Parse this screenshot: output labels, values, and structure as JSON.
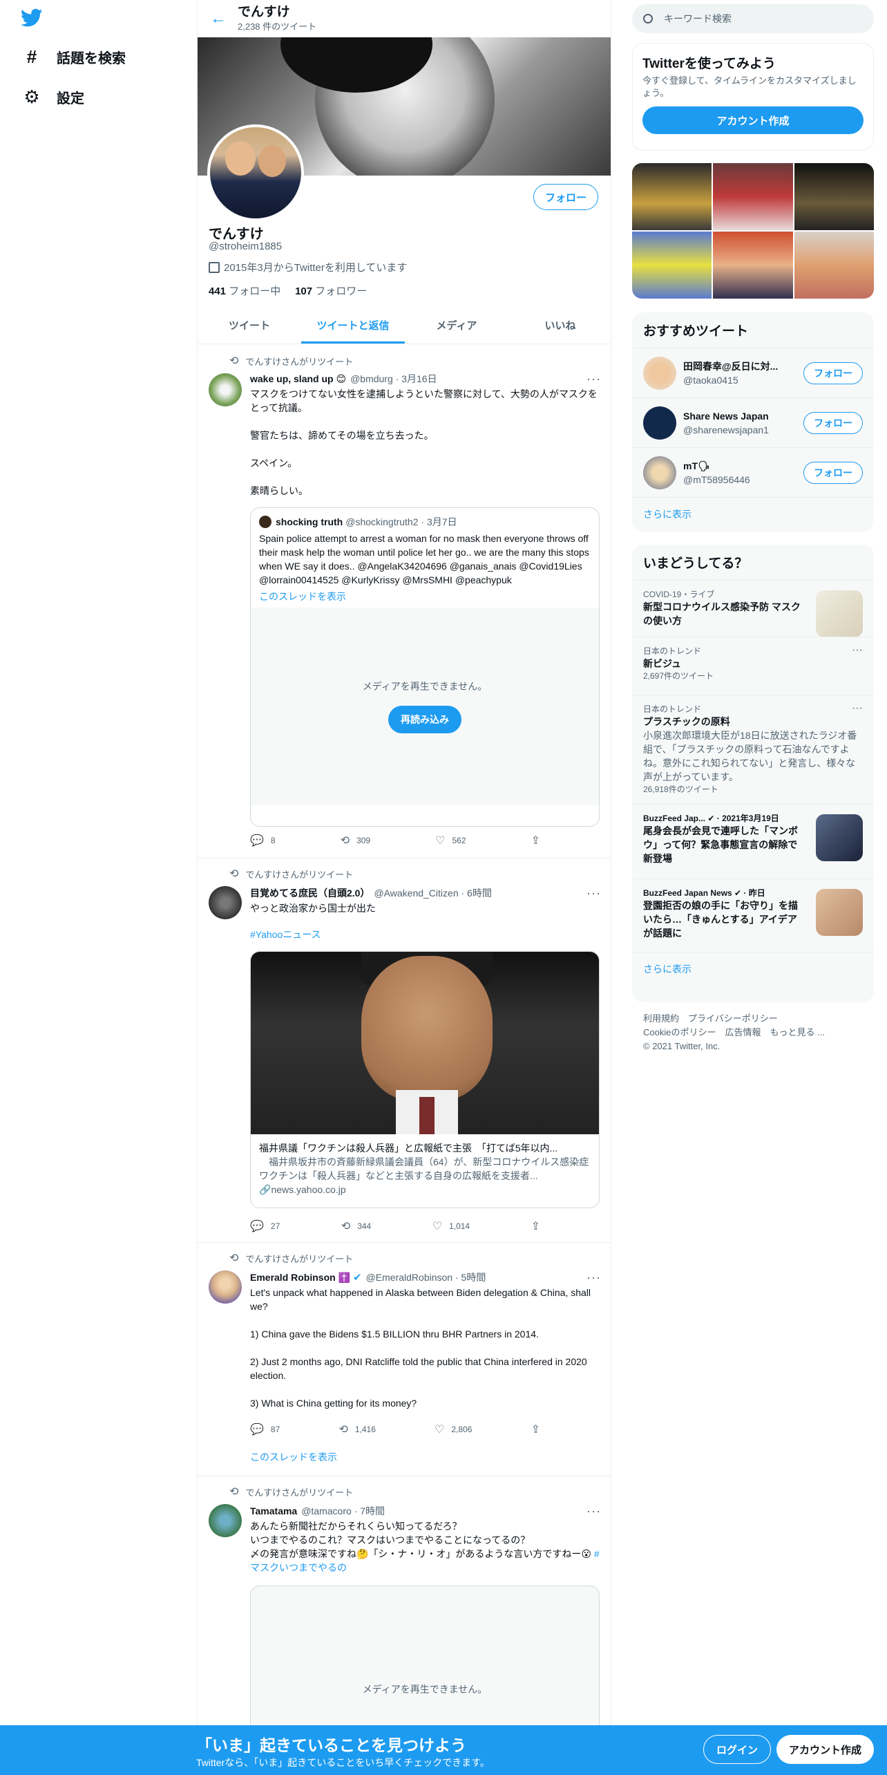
{
  "nav": {
    "explore_label": "話題を検索",
    "settings_label": "設定"
  },
  "header": {
    "name": "でんすけ",
    "tweet_count": "2,238 件のツイート"
  },
  "profile": {
    "follow_label": "フォロー",
    "name": "でんすけ",
    "handle": "@stroheim1885",
    "joined": "2015年3月からTwitterを利用しています",
    "following_count": "441",
    "following_label": "フォロー中",
    "followers_count": "107",
    "followers_label": "フォロワー"
  },
  "tabs": [
    {
      "label": "ツイート"
    },
    {
      "label": "ツイートと返信"
    },
    {
      "label": "メディア"
    },
    {
      "label": "いいね"
    }
  ],
  "tweets": [
    {
      "rt_label": "でんすけさんがリツイート",
      "name": "wake up, sland up 😊",
      "meta": "@bmdurg · 3月16日",
      "body": [
        "マスクをつけてない女性を逮捕しようといた警察に対して、大勢の人がマスクをとって抗議。",
        "警官たちは、諦めてその場を立ち去った。",
        "スペイン。",
        "素晴らしい。"
      ],
      "quote": {
        "name": "shocking truth",
        "meta": "@shockingtruth2 · 3月7日",
        "text": "Spain police attempt to arrest a woman for no mask then everyone throws off their mask help the woman until police let her go.. we are the many this stops when WE say it does.. @AngelaK34204696 @ganais_anais @Covid19Lies @lorrain00414525 @KurlyKrissy @MrsSMHI @peachypuk",
        "thread_link": "このスレッドを表示",
        "media_error": "メディアを再生できません。",
        "reload": "再読み込み"
      },
      "replies": "8",
      "retweets": "309",
      "likes": "562"
    },
    {
      "rt_label": "でんすけさんがリツイート",
      "name": "目覚めてる庶民（自頭2.0）",
      "meta": "@Awakend_Citizen · 6時間",
      "body": [
        "やっと政治家から国士が出た"
      ],
      "hashtag": "#Yahooニュース",
      "card": {
        "title": "福井県議「ワクチンは殺人兵器」と広報紙で主張　「打てば5年以内...",
        "desc": "　福井県坂井市の斉藤新緑県議会議員（64）が、新型コロナウイルス感染症ワクチンは「殺人兵器」などと主張する自身の広報紙を支援者...",
        "url": "news.yahoo.co.jp"
      },
      "replies": "27",
      "retweets": "344",
      "likes": "1,014"
    },
    {
      "rt_label": "でんすけさんがリツイート",
      "name": "Emerald Robinson ✝️",
      "meta": "@EmeraldRobinson · 5時間",
      "body": [
        "Let's unpack what happened in Alaska between Biden delegation & China, shall we?",
        "1) China gave the Bidens $1.5 BILLION thru BHR Partners in 2014.",
        "2) Just 2 months ago, DNI Ratcliffe told the public that China interfered in 2020 election.",
        "3) What is China getting for its money?"
      ],
      "thread_link": "このスレッドを表示",
      "replies": "87",
      "retweets": "1,416",
      "likes": "2,806"
    },
    {
      "rt_label": "でんすけさんがリツイート",
      "name": "Tamatama",
      "meta": "@tamacoro · 7時間",
      "body_lines": [
        "あんたら新聞社だからそれくらい知ってるだろ？",
        "いつまでやるのこれ？マスクはいつまでやることになってるの？",
        "〆の発言が意味深ですね🤔「シ・ナ・リ・オ」があるような言い方ですねー😮"
      ],
      "hashtag": "#マスクいつまでやるの",
      "media_error": "メディアを再生できません。"
    }
  ],
  "right": {
    "search_placeholder": "キーワード検索",
    "signup_title": "Twitterを使ってみよう",
    "signup_sub": "今すぐ登録して、タイムラインをカスタマイズしましょう。",
    "signup_btn": "アカウント作成",
    "suggest_title": "おすすめツイート",
    "suggestions": [
      {
        "name": "田岡春幸@反日に対...",
        "handle": "@taoka0415",
        "follow": "フォロー"
      },
      {
        "name": "Share News Japan",
        "handle": "@sharenewsjapan1",
        "follow": "フォロー"
      },
      {
        "name": "mT🗣",
        "handle": "@mT58956446",
        "follow": "フォロー"
      }
    ],
    "show_more": "さらに表示",
    "trends_title": "いまどうしてる？",
    "trends": [
      {
        "cat": "COVID-19・ライブ",
        "title": "新型コロナウイルス感染予防 マスクの使い方"
      },
      {
        "cat": "日本のトレンド",
        "title": "新ビジュ",
        "count": "2,697件のツイート"
      },
      {
        "cat": "日本のトレンド",
        "title": "プラスチックの原料",
        "desc": "小泉進次郎環境大臣が18日に放送されたラジオ番組で、「プラスチックの原料って石油なんですよね。意外にこれ知られてない」と発言し、様々な声が上がっています。",
        "count": "26,918件のツイート"
      },
      {
        "cat": "BuzzFeed Jap... ✔ · 2021年3月19日",
        "title": "尾身会長が会見で連呼した「マンボウ」って何？緊急事態宣言の解除で新登場"
      },
      {
        "cat": "BuzzFeed Japan News ✔ · 昨日",
        "title": "登園拒否の娘の手に「お守り」を描いたら…「きゅんとする」アイデアが話題に"
      }
    ],
    "trends_more": "さらに表示",
    "footer": [
      "利用規約　プライバシーポリシー",
      "Cookieのポリシー　広告情報　もっと見る ...",
      "© 2021 Twitter, Inc."
    ]
  },
  "bottom": {
    "title": "「いま」起きていることを見つけよう",
    "sub": "Twitterなら、「いま」起きていることをいち早くチェックできます。",
    "login": "ログイン",
    "signup": "アカウント作成"
  },
  "colors": {
    "accent": "#1d9bf0",
    "bottom_bar": "#1d9bf0"
  }
}
